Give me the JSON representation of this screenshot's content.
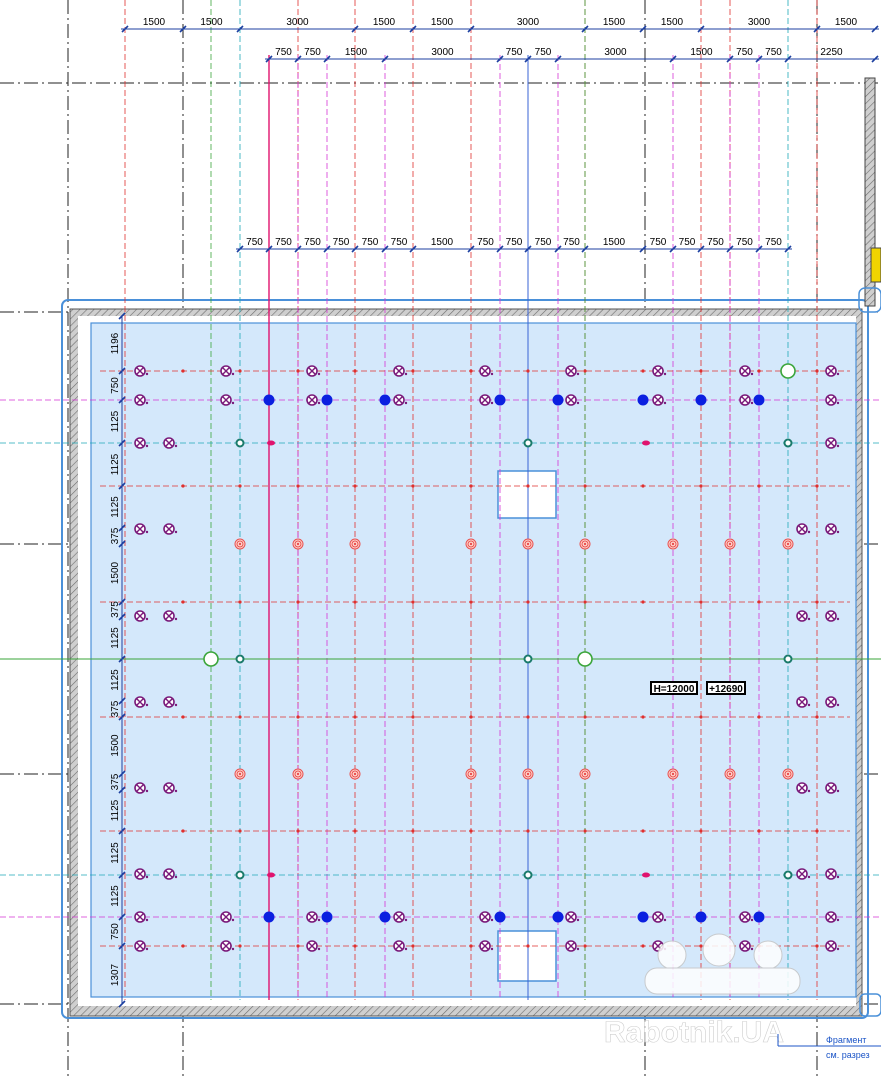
{
  "plan": {
    "title_note": "Фрагмент",
    "ref_note": "см. разрез",
    "elevation_label_1": "H=12000",
    "elevation_label_2": "+12690",
    "watermark": "Rabotnik.UA"
  },
  "dimension_rows": {
    "top_row_1": [
      "1500",
      "1500",
      "3000",
      "1500",
      "1500",
      "3000",
      "1500",
      "1500",
      "3000",
      "1500"
    ],
    "top_row_2": [
      "750",
      "750",
      "1500",
      "3000",
      "750",
      "750",
      "3000",
      "1500",
      "750",
      "750",
      "2250"
    ],
    "top_row_3": [
      "750",
      "750",
      "750",
      "750",
      "750",
      "750",
      "1500",
      "750",
      "750",
      "750",
      "750",
      "1500",
      "750",
      "750",
      "750",
      "750",
      "750"
    ],
    "left_column": [
      "1196",
      "750",
      "1125",
      "1125",
      "1125",
      "375",
      "1500",
      "375",
      "1125",
      "1125",
      "375",
      "1500",
      "375",
      "1125",
      "1125",
      "1125",
      "750",
      "1307"
    ]
  },
  "colors": {
    "slab_fill": "#d4e8fb",
    "slab_outline": "#4a90d9",
    "wall_hatch": "#9a9a9a",
    "red_grid": "#e0302e",
    "magenta_grid": "#d535d5",
    "cyan_grid": "#1fa9b8",
    "green_grid": "#3aa53a",
    "blue_grid": "#3a63d6",
    "dimension_line": "#1c3fa0",
    "sprinkler": "#7a1a7a",
    "lamp": "#e85050",
    "blue_dot": "#0b1fe0",
    "teal_marker": "#1a7a6a"
  },
  "icons": {
    "sprinkler": "crossed-circle-icon",
    "lamp": "concentric-circle-icon",
    "detector": "filled-dot-icon",
    "riser": "open-circle-icon",
    "node": "ring-node-icon"
  }
}
